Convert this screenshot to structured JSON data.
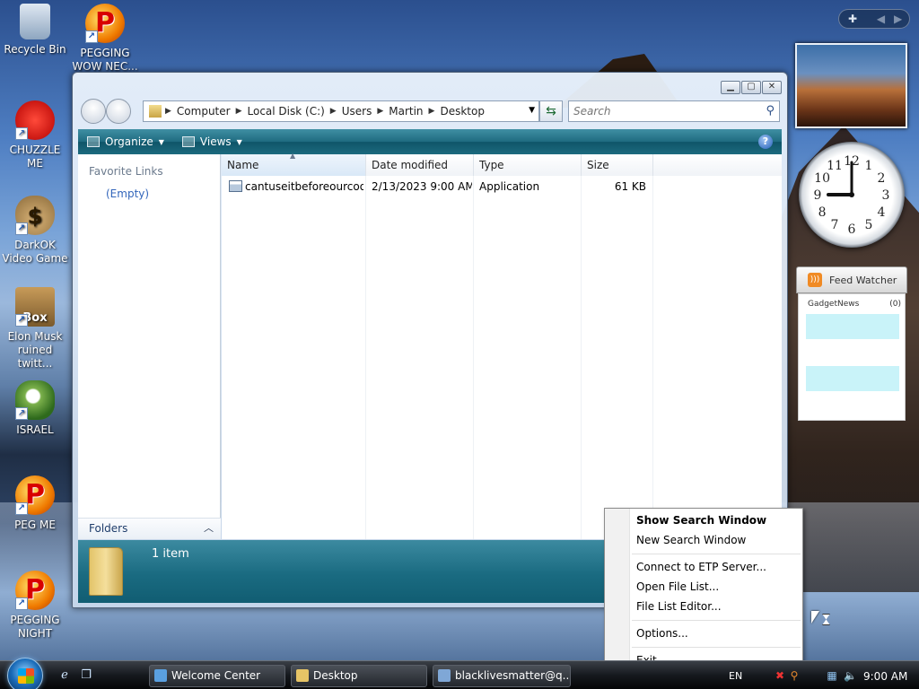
{
  "desktop": {
    "icons": [
      {
        "label": "Recycle Bin"
      },
      {
        "label": "PEGGING WOW NEC..."
      },
      {
        "label": "CHUZZLE ME"
      },
      {
        "label": "DarkOK Video Game"
      },
      {
        "label": "Elon Musk ruined twitt..."
      },
      {
        "label": "ISRAEL"
      },
      {
        "label": "PEG ME"
      },
      {
        "label": "PEGGING NIGHT"
      }
    ],
    "pegball_glyph": "P",
    "money_glyph": "$",
    "box_glyph": "Box"
  },
  "explorer": {
    "breadcrumb": [
      "Computer",
      "Local Disk (C:)",
      "Users",
      "Martin",
      "Desktop"
    ],
    "search_placeholder": "Search",
    "toolbar": {
      "organize": "Organize",
      "views": "Views",
      "help": "?"
    },
    "left_pane": {
      "favorite_links": "Favorite Links",
      "empty": "(Empty)",
      "folders": "Folders"
    },
    "columns": {
      "name": "Name",
      "date_modified": "Date modified",
      "type": "Type",
      "size": "Size"
    },
    "files": [
      {
        "name": "cantuseitbeforeourcoo...",
        "date": "2/13/2023 9:00 AM",
        "type": "Application",
        "size": "61 KB"
      }
    ],
    "details": {
      "count": "1 item"
    }
  },
  "gadgets": {
    "feed": {
      "title": "Feed Watcher",
      "source": "GadgetNews",
      "count": "(0)"
    },
    "clock": {
      "hour": 9,
      "minute": 0
    }
  },
  "context_menu": {
    "items": [
      {
        "label": "Show Search Window"
      },
      {
        "label": "New Search Window"
      },
      {
        "label": "Connect to ETP Server..."
      },
      {
        "label": "Open File List..."
      },
      {
        "label": "File List Editor..."
      },
      {
        "label": "Options..."
      },
      {
        "label": "Exit"
      }
    ]
  },
  "taskbar": {
    "tasks": [
      {
        "label": "Welcome Center"
      },
      {
        "label": "Desktop"
      },
      {
        "label": "blacklivesmatter@q..."
      }
    ],
    "language": "EN",
    "clock": "9:00 AM"
  },
  "colors": {
    "toolbar_teal": "#1f6b80",
    "link_blue": "#3366bb",
    "feed_row": "#c9f3f9"
  }
}
